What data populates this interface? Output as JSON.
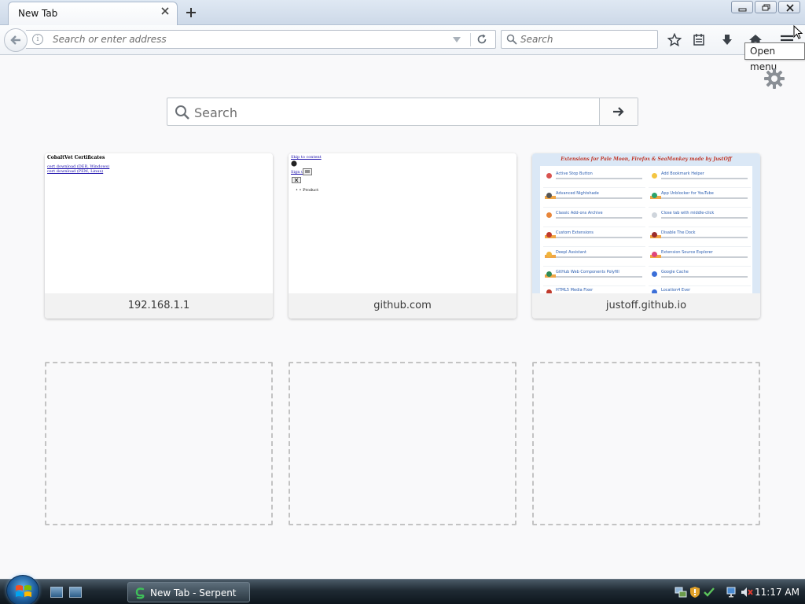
{
  "window": {
    "tab_title": "New Tab",
    "tab_close_icon": "close-icon",
    "new_tab_icon": "plus-icon"
  },
  "navbar": {
    "url_placeholder": "Search or enter address",
    "search_placeholder": "Search",
    "tooltip": "Open menu"
  },
  "newtab": {
    "search_placeholder": "Search",
    "tiles": [
      {
        "label": "192.168.1.1",
        "thumb_title": "CobaltVet Certificates",
        "thumb_links": [
          "cert download (DER, Windows)",
          "cert download (PEM, Linux)"
        ]
      },
      {
        "label": "github.com",
        "thumb_links": [
          "Skip to content",
          "Sign up"
        ],
        "thumb_item": "• • Product"
      },
      {
        "label": "justoff.github.io",
        "thumb_title": "Extensions for Pale Moon, Firefox & SeaMonkey made by JustOff",
        "thumb_items": [
          "Active Stop Button",
          "Add Bookmark Helper",
          "Advanced Nightshade",
          "App Unblocker for YouTube",
          "Classic Add-ons Archive",
          "Close tab with middle-click",
          "Custom Extensions",
          "Disable The Dock",
          "Deepl Assistant",
          "Extension Source Explorer",
          "GitHub Web Components Polyfill",
          "Google Cache",
          "HTML5 Media Fixer",
          "Location4 Ever"
        ]
      }
    ]
  },
  "taskbar": {
    "task_label": "New Tab - Serpent",
    "clock": "11:17 AM"
  },
  "colors": {
    "page_bg": "#f9f9fa",
    "accent_link": "#1a0dab",
    "badge_orange": "#f0a646"
  }
}
